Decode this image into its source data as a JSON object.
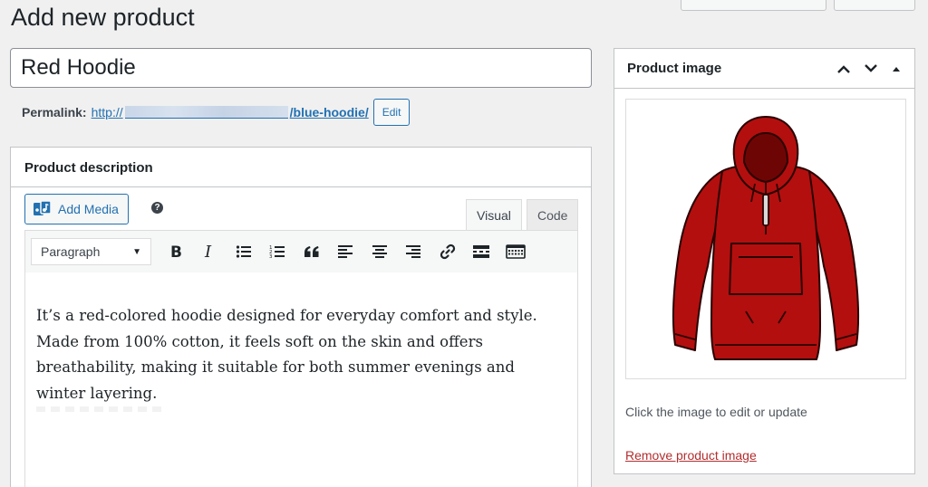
{
  "page": {
    "title": "Add new product"
  },
  "product": {
    "title": "Red Hoodie"
  },
  "permalink": {
    "label": "Permalink:",
    "prefix": "http://",
    "slug": "/blue-hoodie/",
    "edit_label": "Edit"
  },
  "description": {
    "heading": "Product description",
    "add_media_label": "Add Media",
    "tabs": {
      "visual": "Visual",
      "code": "Code"
    },
    "format_value": "Paragraph",
    "toolbar_icons": [
      "bold-icon",
      "italic-icon",
      "bulleted-list-icon",
      "numbered-list-icon",
      "blockquote-icon",
      "align-left-icon",
      "align-center-icon",
      "align-right-icon",
      "link-icon",
      "read-more-icon",
      "toolbar-toggle-icon"
    ],
    "body_text": "It’s a red-colored hoodie designed for everyday comfort and style. Made from 100% cotton, it feels soft on the skin and offers breathability, making it suitable for both summer evenings and winter layering."
  },
  "product_image": {
    "heading": "Product image",
    "caption": "Click the image to edit or update",
    "remove_label": "Remove product image",
    "hoodie_color": "#b30f0f"
  },
  "colors": {
    "accent": "#2271b1",
    "danger": "#b32d2e"
  }
}
